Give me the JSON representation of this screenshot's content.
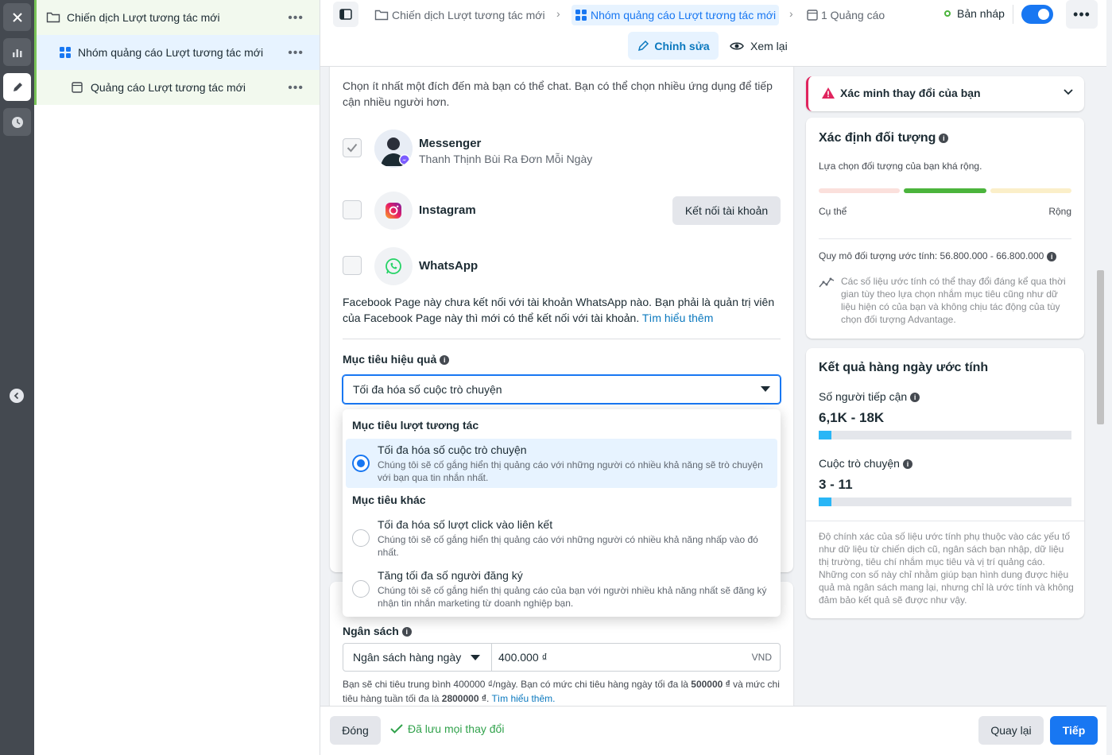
{
  "tree": {
    "campaign": "Chiến dịch Lượt tương tác mới",
    "adset": "Nhóm quảng cáo Lượt tương tác mới",
    "ad": "Quảng cáo Lượt tương tác mới"
  },
  "breadcrumb": {
    "campaign": "Chiến dịch Lượt tương tác mới",
    "adset": "Nhóm quảng cáo Lượt tương tác mới",
    "ad": "1 Quảng cáo"
  },
  "status": "Bản nháp",
  "modes": {
    "edit": "Chỉnh sửa",
    "review": "Xem lại"
  },
  "apps": {
    "intro": "Chọn ít nhất một đích đến mà bạn có thể chat. Bạn có thể chọn nhiều ứng dụng để tiếp cận nhiều người hơn.",
    "messenger": {
      "name": "Messenger",
      "page": "Thanh Thịnh Bùi Ra Đơn Mỗi Ngày"
    },
    "instagram": {
      "name": "Instagram",
      "connect": "Kết nối tài khoản"
    },
    "whatsapp": {
      "name": "WhatsApp"
    },
    "whatsapp_note": "Facebook Page này chưa kết nối với tài khoản WhatsApp nào. Bạn phải là quản trị viên của Facebook Page này thì mới có thể kết nối với tài khoản.",
    "learn_more": "Tìm hiểu thêm"
  },
  "goal": {
    "label": "Mục tiêu hiệu quả",
    "selected": "Tối đa hóa số cuộc trò chuyện",
    "group1": "Mục tiêu lượt tương tác",
    "group2": "Mục tiêu khác",
    "options": [
      {
        "title": "Tối đa hóa số cuộc trò chuyện",
        "desc": "Chúng tôi sẽ cố gắng hiển thị quảng cáo với những người có nhiều khả năng sẽ trò chuyện với bạn qua tin nhắn nhất."
      },
      {
        "title": "Tối đa hóa số lượt click vào liên kết",
        "desc": "Chúng tôi sẽ cố gắng hiển thị quảng cáo với những người có nhiều khả năng nhấp vào đó nhất."
      },
      {
        "title": "Tăng tối đa số người đăng ký",
        "desc": "Chúng tôi sẽ cố gắng hiển thị quảng cáo của bạn với người nhiều khả năng nhất sẽ đăng ký nhận tin nhắn marketing từ doanh nghiệp bạn."
      }
    ]
  },
  "budget": {
    "label": "Ngân sách",
    "type": "Ngân sách hàng ngày",
    "amount": "400.000 ₫",
    "currency": "VND",
    "note_a": "Bạn sẽ chi tiêu trung bình 400000 ₫/ngày. Bạn có mức chi tiêu hàng ngày tối đa là",
    "note_max_day": "500000 ₫",
    "note_b": "và mức chi tiêu hàng tuần tối đa là",
    "note_max_week": "2800000 ₫",
    "note_link": "Tìm hiểu thêm."
  },
  "verify": "Xác minh thay đổi của bạn",
  "audience": {
    "title": "Xác định đối tượng",
    "desc": "Lựa chọn đối tượng của bạn khá rộng.",
    "specific": "Cụ thể",
    "broad": "Rộng",
    "size_label": "Quy mô đối tượng ước tính: 56.800.000 - 66.800.000",
    "size_note": "Các số liệu ước tính có thể thay đổi đáng kể qua thời gian tùy theo lựa chọn nhắm mục tiêu cũng như dữ liệu hiện có của bạn và không chịu tác động của tùy chọn đối tượng Advantage."
  },
  "results": {
    "title": "Kết quả hàng ngày ước tính",
    "reach_label": "Số người tiếp cận",
    "reach_value": "6,1K - 18K",
    "reach_fill": 0.05,
    "conv_label": "Cuộc trò chuyện",
    "conv_value": "3 - 11",
    "conv_fill": 0.05,
    "disclaimer": "Độ chính xác của số liệu ước tính phụ thuộc vào các yếu tố như dữ liệu từ chiến dịch cũ, ngân sách bạn nhập, dữ liệu thị trường, tiêu chí nhắm mục tiêu và vị trí quảng cáo. Những con số này chỉ nhằm giúp bạn hình dung được hiệu quả mà ngân sách mang lại, nhưng chỉ là ước tính và không đảm bảo kết quả sẽ được như vậy."
  },
  "footer": {
    "close": "Đóng",
    "saved": "Đã lưu mọi thay đổi",
    "back": "Quay lại",
    "next": "Tiếp"
  },
  "colors": {
    "accent": "#1877f2",
    "green": "#78c257",
    "bar": "#29b6f6"
  }
}
